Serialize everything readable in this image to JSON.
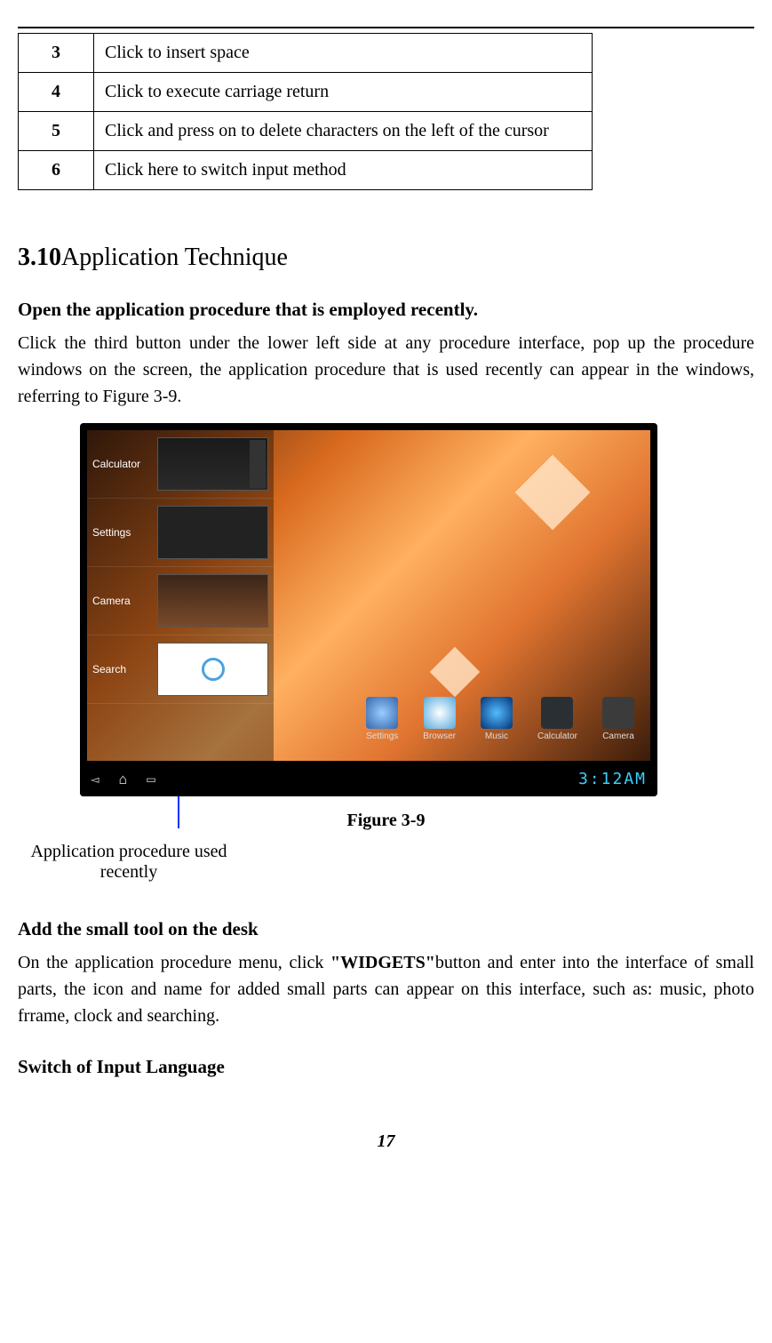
{
  "table": {
    "rows": [
      {
        "num": "3",
        "desc": "Click to insert space"
      },
      {
        "num": "4",
        "desc": "Click to execute carriage return"
      },
      {
        "num": "5",
        "desc": "Click and press on to delete characters on the left of the cursor"
      },
      {
        "num": "6",
        "desc": "Click here to switch input method"
      }
    ]
  },
  "section": {
    "number": "3.10",
    "title": "Application Technique"
  },
  "open_recent": {
    "heading": "Open the application procedure that is employed recently.",
    "body": "Click the third button under the lower left side at any procedure interface, pop up the procedure windows on the screen, the application procedure that is used recently can appear in the windows, referring to Figure 3-9."
  },
  "figure": {
    "caption": "Figure 3-9",
    "callout": "Application procedure used recently",
    "recent_items": [
      "Calculator",
      "Settings",
      "Camera",
      "Search"
    ],
    "dock_items": [
      "Settings",
      "Browser",
      "Music",
      "Calculator",
      "Camera"
    ],
    "clock": "3:12AM"
  },
  "add_tool": {
    "heading": "Add the small tool on the desk",
    "body_pre": "On the application procedure menu, click ",
    "body_bold": "\"WIDGETS\"",
    "body_post": "button and enter into the interface of small parts, the icon and name for added small parts can appear on this interface, such as: music, photo frrame, clock and searching."
  },
  "switch_lang": {
    "heading": "Switch of Input Language"
  },
  "page_number": "17"
}
